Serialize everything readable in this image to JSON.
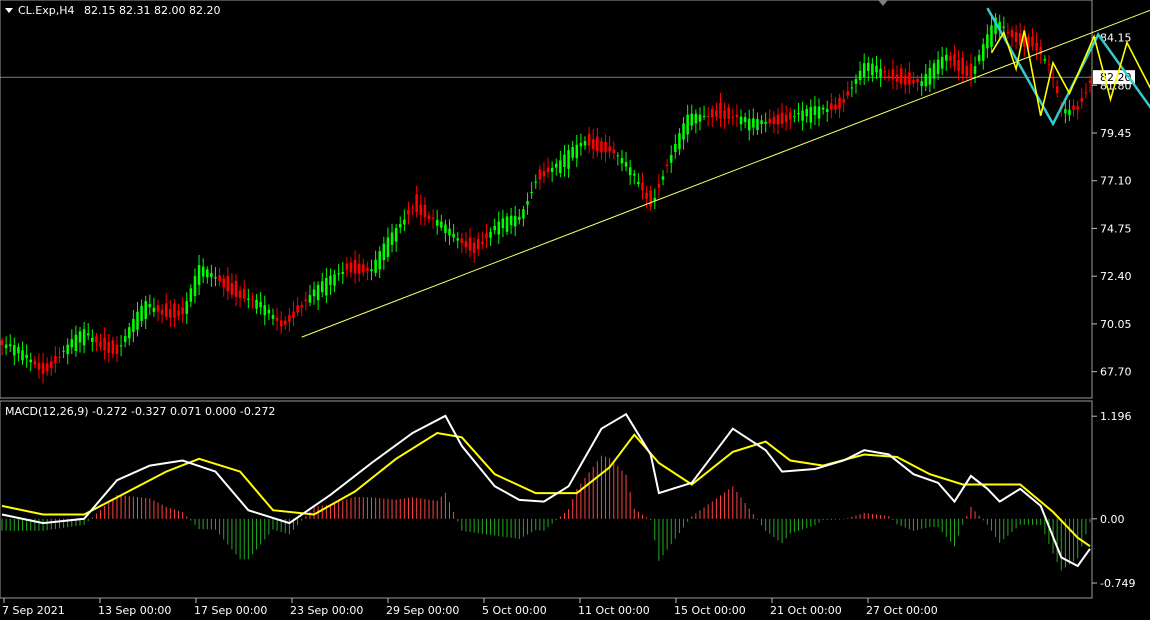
{
  "header": {
    "symbol": "CL.Exp,H4",
    "ohlc": "82.15 82.31 82.00 82.20"
  },
  "indicator": {
    "label": "MACD(12,26,9) -0.272 -0.327 0.071 0.000 -0.272"
  },
  "colors": {
    "background": "#000000",
    "bull": "#00ff00",
    "bear": "#ff0000",
    "trend": "#ffff66",
    "projection_yellow": "#ffff00",
    "projection_cyan": "#33cccc",
    "macd_line": "#ffffff",
    "signal_line": "#ffff00",
    "hist_pos": "#ff4444",
    "hist_neg": "#22aa22",
    "grid_text": "#ffffff"
  },
  "chart_data": [
    {
      "type": "candlestick",
      "price_ticks": [
        "84.15",
        "81.80",
        "79.45",
        "77.10",
        "74.75",
        "72.40",
        "70.05",
        "67.70"
      ],
      "current_price_label": "82.20",
      "current_price": 82.2,
      "ylim": [
        66.5,
        85.9
      ],
      "x_ticks": [
        "7 Sep 2021",
        "13 Sep 00:00",
        "17 Sep 00:00",
        "23 Sep 00:00",
        "29 Sep 00:00",
        "5 Oct 00:00",
        "11 Oct 00:00",
        "15 Oct 00:00",
        "21 Oct 00:00",
        "27 Oct 00:00"
      ],
      "close_path": [
        [
          0,
          69.0
        ],
        [
          10,
          67.9
        ],
        [
          20,
          69.5
        ],
        [
          28,
          68.8
        ],
        [
          35,
          70.9
        ],
        [
          44,
          70.6
        ],
        [
          48,
          72.6
        ],
        [
          53,
          72.3
        ],
        [
          60,
          71.2
        ],
        [
          68,
          70.1
        ],
        [
          72,
          70.9
        ],
        [
          78,
          71.8
        ],
        [
          84,
          73.0
        ],
        [
          90,
          72.6
        ],
        [
          96,
          74.7
        ],
        [
          100,
          76.1
        ],
        [
          104,
          75.2
        ],
        [
          110,
          74.3
        ],
        [
          115,
          73.9
        ],
        [
          120,
          74.7
        ],
        [
          126,
          75.3
        ],
        [
          130,
          77.4
        ],
        [
          136,
          77.8
        ],
        [
          142,
          79.2
        ],
        [
          148,
          78.6
        ],
        [
          154,
          77.2
        ],
        [
          158,
          76.1
        ],
        [
          161,
          77.6
        ],
        [
          167,
          80.0
        ],
        [
          174,
          80.6
        ],
        [
          182,
          79.8
        ],
        [
          188,
          80.2
        ],
        [
          196,
          80.3
        ],
        [
          204,
          81.0
        ],
        [
          210,
          82.6
        ],
        [
          218,
          82.3
        ],
        [
          224,
          81.8
        ],
        [
          230,
          83.3
        ],
        [
          236,
          82.4
        ],
        [
          242,
          84.8
        ],
        [
          248,
          84.1
        ],
        [
          251,
          83.9
        ],
        [
          255,
          82.5
        ],
        [
          258,
          80.4
        ],
        [
          262,
          80.9
        ],
        [
          265,
          82.2
        ]
      ],
      "trendline": {
        "start": [
          73,
          69.4
        ],
        "end": [
          290,
          86.3
        ]
      },
      "macd": {
        "ylim": [
          -0.9,
          1.35
        ],
        "ticks": [
          "1.196",
          "0.00",
          "-0.749"
        ],
        "macd_path": [
          [
            0,
            0.05
          ],
          [
            10,
            -0.05
          ],
          [
            20,
            0.0
          ],
          [
            28,
            0.45
          ],
          [
            36,
            0.62
          ],
          [
            44,
            0.68
          ],
          [
            52,
            0.55
          ],
          [
            60,
            0.1
          ],
          [
            70,
            -0.05
          ],
          [
            80,
            0.28
          ],
          [
            90,
            0.65
          ],
          [
            100,
            1.0
          ],
          [
            108,
            1.2
          ],
          [
            112,
            0.85
          ],
          [
            120,
            0.38
          ],
          [
            126,
            0.22
          ],
          [
            132,
            0.2
          ],
          [
            138,
            0.38
          ],
          [
            146,
            1.05
          ],
          [
            152,
            1.22
          ],
          [
            158,
            0.75
          ],
          [
            160,
            0.3
          ],
          [
            168,
            0.42
          ],
          [
            178,
            1.05
          ],
          [
            186,
            0.8
          ],
          [
            190,
            0.55
          ],
          [
            198,
            0.58
          ],
          [
            205,
            0.68
          ],
          [
            210,
            0.8
          ],
          [
            216,
            0.75
          ],
          [
            222,
            0.52
          ],
          [
            228,
            0.42
          ],
          [
            232,
            0.2
          ],
          [
            236,
            0.5
          ],
          [
            240,
            0.35
          ],
          [
            243,
            0.2
          ],
          [
            248,
            0.35
          ],
          [
            253,
            0.15
          ],
          [
            258,
            -0.45
          ],
          [
            262,
            -0.55
          ],
          [
            265,
            -0.35
          ]
        ],
        "signal_path": [
          [
            0,
            0.15
          ],
          [
            10,
            0.05
          ],
          [
            20,
            0.05
          ],
          [
            30,
            0.3
          ],
          [
            40,
            0.55
          ],
          [
            48,
            0.7
          ],
          [
            58,
            0.55
          ],
          [
            66,
            0.1
          ],
          [
            76,
            0.05
          ],
          [
            86,
            0.32
          ],
          [
            96,
            0.7
          ],
          [
            106,
            1.0
          ],
          [
            112,
            0.95
          ],
          [
            120,
            0.52
          ],
          [
            130,
            0.3
          ],
          [
            140,
            0.3
          ],
          [
            148,
            0.6
          ],
          [
            154,
            0.98
          ],
          [
            160,
            0.65
          ],
          [
            168,
            0.4
          ],
          [
            178,
            0.78
          ],
          [
            186,
            0.9
          ],
          [
            192,
            0.68
          ],
          [
            200,
            0.62
          ],
          [
            210,
            0.75
          ],
          [
            218,
            0.72
          ],
          [
            226,
            0.52
          ],
          [
            234,
            0.4
          ],
          [
            242,
            0.4
          ],
          [
            248,
            0.4
          ],
          [
            256,
            0.08
          ],
          [
            262,
            -0.22
          ],
          [
            265,
            -0.32
          ]
        ]
      }
    }
  ],
  "annotations": {
    "yellow_path": [
      [
        241,
        83.4
      ],
      [
        244,
        84.4
      ],
      [
        247,
        82.6
      ],
      [
        249,
        84.5
      ],
      [
        253,
        80.3
      ],
      [
        256,
        82.9
      ],
      [
        260,
        81.4
      ],
      [
        266,
        84.2
      ],
      [
        270,
        81.1
      ],
      [
        274,
        83.9
      ],
      [
        289,
        78.0
      ]
    ],
    "cyan_path": [
      [
        240,
        85.6
      ],
      [
        256,
        79.9
      ],
      [
        267,
        84.3
      ],
      [
        289,
        78.1
      ]
    ]
  }
}
